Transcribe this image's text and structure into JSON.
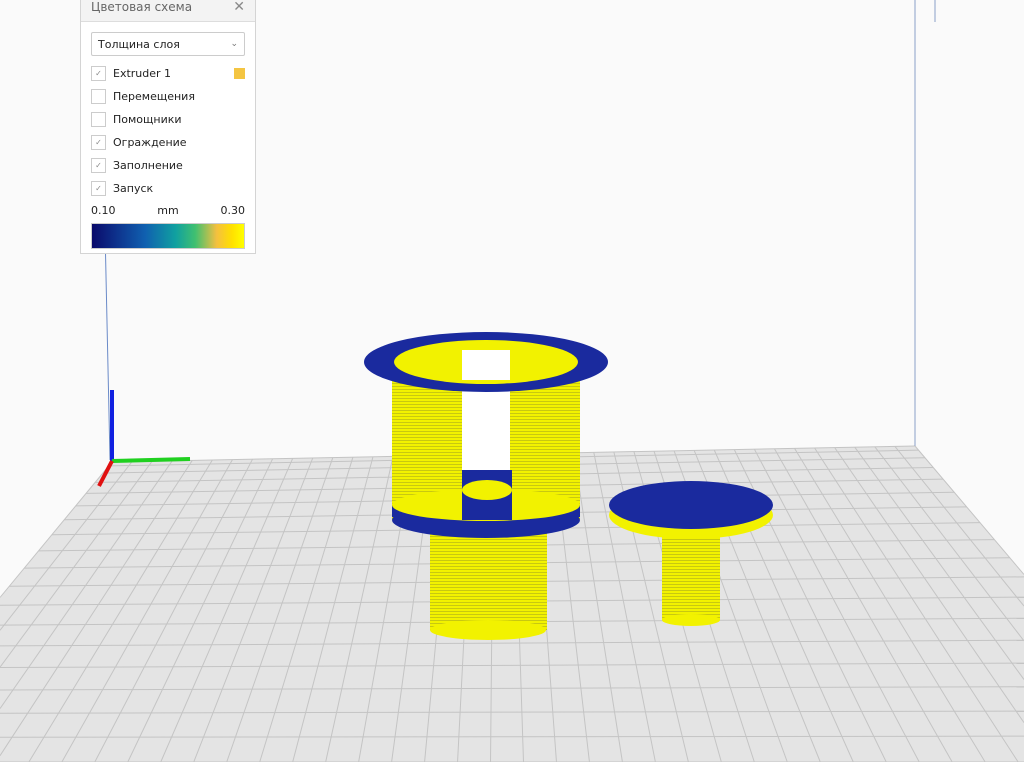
{
  "panel": {
    "title": "Цветовая схема",
    "close_icon": "close-icon",
    "scheme_select": "Толщина слоя",
    "items": [
      {
        "label": "Extruder 1",
        "checked": true,
        "color": "#f4c542"
      },
      {
        "label": "Перемещения",
        "checked": false
      },
      {
        "label": "Помощники",
        "checked": false
      },
      {
        "label": "Ограждение",
        "checked": true
      },
      {
        "label": "Заполнение",
        "checked": true
      },
      {
        "label": "Запуск",
        "checked": true
      }
    ],
    "legend": {
      "min": "0.10",
      "unit": "mm",
      "max": "0.30"
    }
  },
  "colors": {
    "yellow": "#f2f200",
    "blue": "#1a2a9e",
    "plate": "#e6e6e6",
    "grid": "#c8c8c8"
  }
}
